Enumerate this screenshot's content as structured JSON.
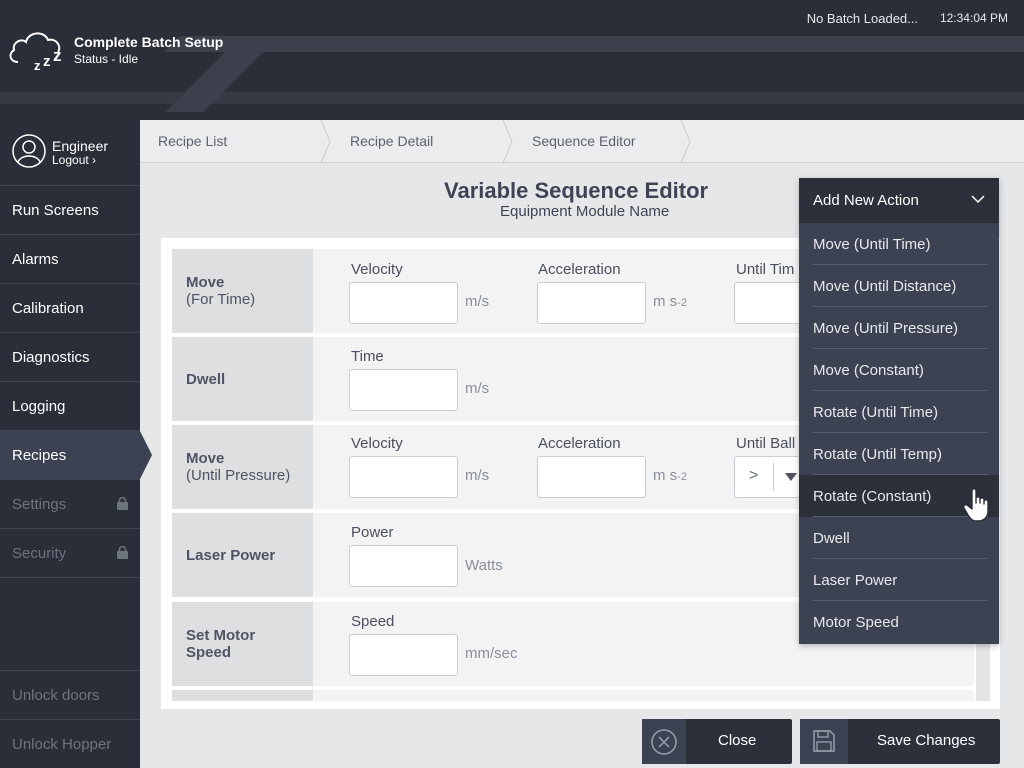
{
  "header": {
    "app_title": "Complete Batch Setup",
    "status": "Status - Idle",
    "batch": "No Batch Loaded...",
    "time": "12:34:04 PM"
  },
  "user": {
    "role": "Engineer",
    "logout": "Logout"
  },
  "sidebar": {
    "items": [
      {
        "label": "Run Screens",
        "state": "normal"
      },
      {
        "label": "Alarms",
        "state": "normal"
      },
      {
        "label": "Calibration",
        "state": "normal"
      },
      {
        "label": "Diagnostics",
        "state": "normal"
      },
      {
        "label": "Logging",
        "state": "normal"
      },
      {
        "label": "Recipes",
        "state": "active"
      },
      {
        "label": "Settings",
        "state": "locked"
      },
      {
        "label": "Security",
        "state": "locked"
      }
    ],
    "bottom": [
      "Unlock doors",
      "Unlock Hopper"
    ]
  },
  "breadcrumb": [
    "Recipe List",
    "Recipe Detail",
    "Sequence Editor"
  ],
  "page": {
    "title": "Variable Sequence Editor",
    "subtitle": "Equipment Module Name"
  },
  "rows": [
    {
      "name": "Move",
      "sub": "(For Time)",
      "fields": [
        {
          "label": "Velocity",
          "unit": "m/s",
          "value": ""
        },
        {
          "label": "Acceleration",
          "unit": "m s",
          "unit_sup": "-2",
          "value": ""
        },
        {
          "label": "Until Tim",
          "value": ""
        }
      ]
    },
    {
      "name": "Dwell",
      "fields": [
        {
          "label": "Time",
          "unit": "m/s",
          "value": ""
        }
      ]
    },
    {
      "name": "Move",
      "sub": "(Until Pressure)",
      "fields": [
        {
          "label": "Velocity",
          "unit": "m/s",
          "value": ""
        },
        {
          "label": "Acceleration",
          "unit": "m s",
          "unit_sup": "-2",
          "value": ""
        },
        {
          "label": "Until Ball",
          "comparator": ">"
        }
      ]
    },
    {
      "name": "Laser Power",
      "fields": [
        {
          "label": "Power",
          "unit": "Watts",
          "value": ""
        }
      ]
    },
    {
      "name": "Set Motor",
      "name2": "Speed",
      "fields": [
        {
          "label": "Speed",
          "unit": "mm/sec",
          "value": ""
        }
      ]
    }
  ],
  "dropdown": {
    "header": "Add New Action",
    "items": [
      "Move (Until Time)",
      "Move (Until Distance)",
      "Move (Until Pressure)",
      "Move (Constant)",
      "Rotate (Until Time)",
      "Rotate (Until Temp)",
      "Rotate (Constant)",
      "Dwell",
      "Laser Power",
      "Motor Speed"
    ],
    "hovered_index": 6
  },
  "footer": {
    "close": "Close",
    "save": "Save Changes"
  },
  "colors": {
    "dark": "#2a2e38",
    "panel_dark": "#3d4252",
    "background": "#e6e7e9"
  }
}
